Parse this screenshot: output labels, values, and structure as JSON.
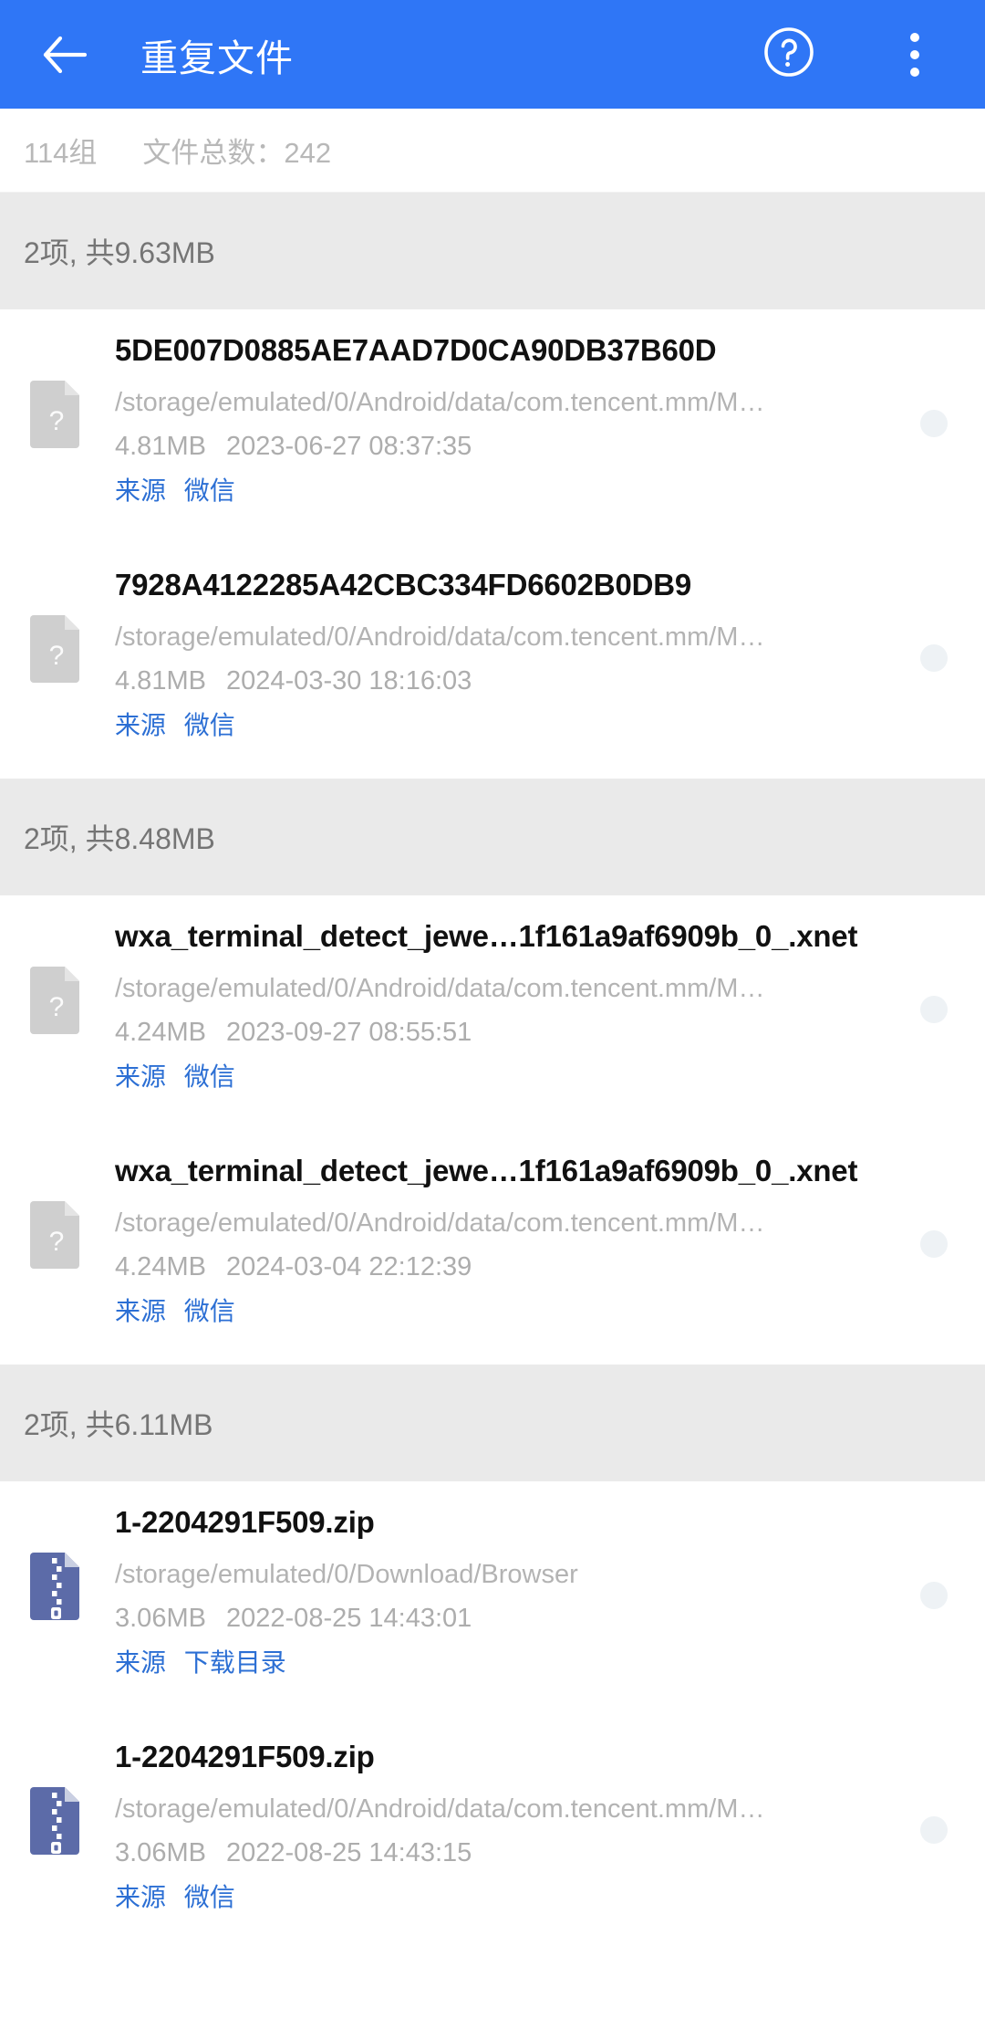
{
  "appbar": {
    "back_icon": "arrow-left-icon",
    "title": "重复文件",
    "help_icon": "help-circle-icon",
    "overflow_icon": "more-vertical-icon",
    "background_color": "#2f76f6"
  },
  "stats": {
    "groups": "114组",
    "total": "文件总数：242"
  },
  "colors": {
    "accent": "#2f76f6",
    "link": "#2c6fd4",
    "group_band": "#eaeaea",
    "zip_icon": "#5c6ba8",
    "unknown_icon": "#cfcfcf"
  },
  "groups": [
    {
      "summary": "2项, 共9.63MB",
      "files": [
        {
          "name": "5DE007D0885AE7AAD7D0CA90DB37B60D",
          "path": "/storage/emulated/0/Android/data/com.tencent.mm/M…",
          "size": "4.81MB",
          "datetime": "2023-06-27 08:37:35",
          "source_label": "来源",
          "source_value": "微信",
          "icon": "unknown-file-icon",
          "selected": false
        },
        {
          "name": "7928A4122285A42CBC334FD6602B0DB9",
          "path": "/storage/emulated/0/Android/data/com.tencent.mm/M…",
          "size": "4.81MB",
          "datetime": "2024-03-30 18:16:03",
          "source_label": "来源",
          "source_value": "微信",
          "icon": "unknown-file-icon",
          "selected": false
        }
      ]
    },
    {
      "summary": "2项, 共8.48MB",
      "files": [
        {
          "name": "wxa_terminal_detect_jewe…1f161a9af6909b_0_.xnet",
          "path": "/storage/emulated/0/Android/data/com.tencent.mm/M…",
          "size": "4.24MB",
          "datetime": "2023-09-27 08:55:51",
          "source_label": "来源",
          "source_value": "微信",
          "icon": "unknown-file-icon",
          "selected": false
        },
        {
          "name": "wxa_terminal_detect_jewe…1f161a9af6909b_0_.xnet",
          "path": "/storage/emulated/0/Android/data/com.tencent.mm/M…",
          "size": "4.24MB",
          "datetime": "2024-03-04 22:12:39",
          "source_label": "来源",
          "source_value": "微信",
          "icon": "unknown-file-icon",
          "selected": false
        }
      ]
    },
    {
      "summary": "2项, 共6.11MB",
      "files": [
        {
          "name": "1-2204291F509.zip",
          "path": "/storage/emulated/0/Download/Browser",
          "size": "3.06MB",
          "datetime": "2022-08-25 14:43:01",
          "source_label": "来源",
          "source_value": "下载目录",
          "icon": "zip-file-icon",
          "selected": false
        },
        {
          "name": "1-2204291F509.zip",
          "path": "/storage/emulated/0/Android/data/com.tencent.mm/M…",
          "size": "3.06MB",
          "datetime": "2022-08-25 14:43:15",
          "source_label": "来源",
          "source_value": "微信",
          "icon": "zip-file-icon",
          "selected": false
        }
      ]
    }
  ]
}
